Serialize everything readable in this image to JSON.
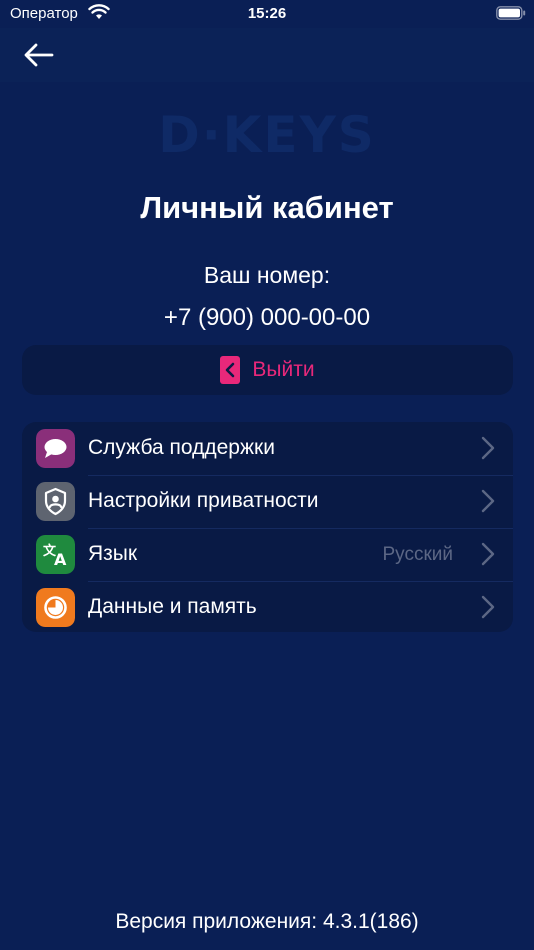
{
  "status_bar": {
    "carrier": "Оператор",
    "time": "15:26",
    "wifi_icon": "wifi-icon",
    "battery_icon": "battery-icon"
  },
  "navbar": {
    "back_icon": "arrow-left-icon"
  },
  "logo": {
    "text": "D·KEYS",
    "color": "#0f2a66"
  },
  "profile": {
    "title": "Личный кабинет",
    "number_label": "Ваш номер:",
    "number_value": "+7 (900) 000-00-00"
  },
  "logout": {
    "label": "Выйти",
    "icon": "logout-door-icon",
    "color": "#e8287a"
  },
  "menu": {
    "items": [
      {
        "label": "Служба поддержки",
        "value": "",
        "icon": "chat-bubble-icon",
        "icon_color": "#8a2f7a"
      },
      {
        "label": "Настройки приватности",
        "value": "",
        "icon": "shield-user-icon",
        "icon_color": "#5e6470"
      },
      {
        "label": "Язык",
        "value": "Русский",
        "icon": "translate-icon",
        "icon_color": "#1f8a3e"
      },
      {
        "label": "Данные и память",
        "value": "",
        "icon": "storage-pie-icon",
        "icon_color": "#f07a1e"
      }
    ]
  },
  "footer": {
    "version": "Версия приложения: 4.3.1(186)"
  },
  "colors": {
    "background": "#0a1f55",
    "card": "#091a45",
    "accent": "#e8287a",
    "secondary_text": "#5c6785"
  }
}
